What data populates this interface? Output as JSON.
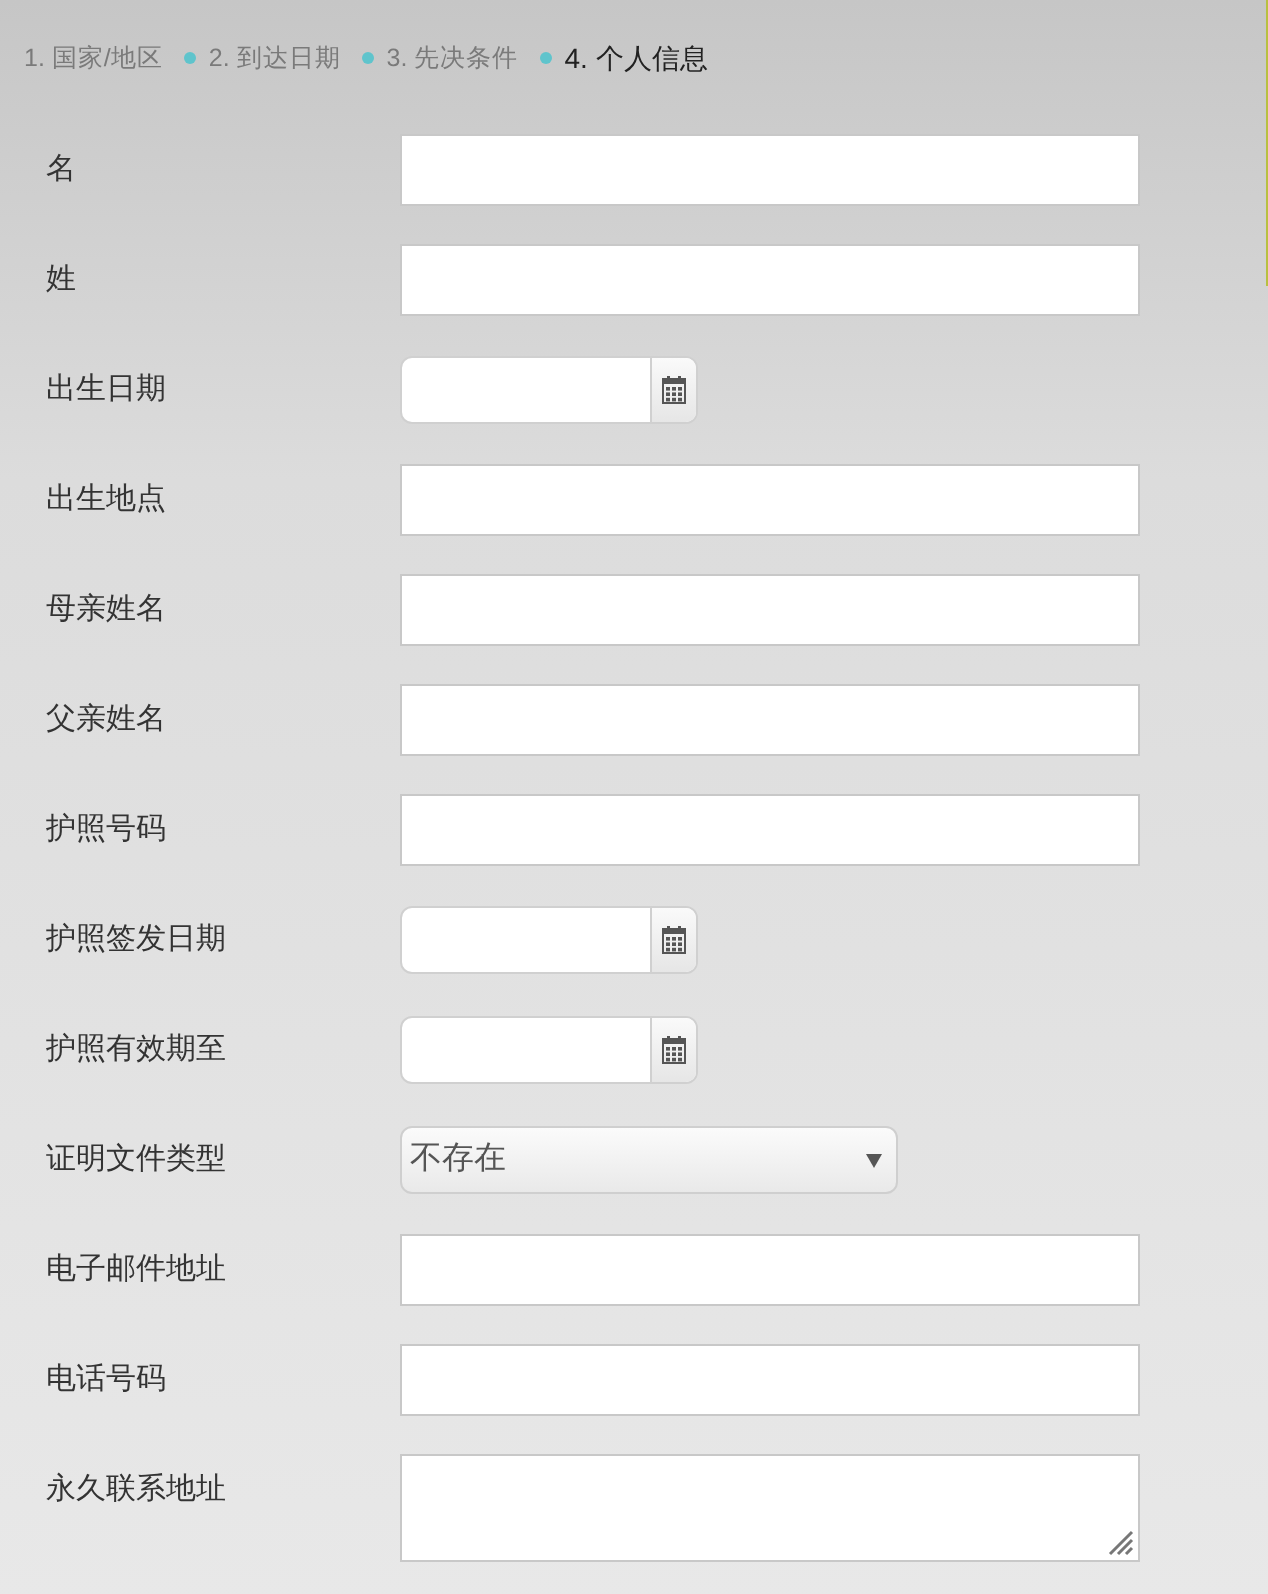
{
  "breadcrumb": [
    {
      "label": "1. 国家/地区",
      "selected": false
    },
    {
      "label": "2. 到达日期",
      "selected": false
    },
    {
      "label": "3. 先决条件",
      "selected": false
    },
    {
      "label": "4. 个人信息",
      "selected": true
    }
  ],
  "fields": [
    {
      "label": "名",
      "kind": "text"
    },
    {
      "label": "姓",
      "kind": "text"
    },
    {
      "label": "出生日期",
      "kind": "date"
    },
    {
      "label": "出生地点",
      "kind": "text"
    },
    {
      "label": "母亲姓名",
      "kind": "text"
    },
    {
      "label": "父亲姓名",
      "kind": "text"
    },
    {
      "label": "护照号码",
      "kind": "text"
    },
    {
      "label": "护照签发日期",
      "kind": "date"
    },
    {
      "label": "护照有效期至",
      "kind": "date"
    },
    {
      "label": "证明文件类型",
      "kind": "select",
      "value": "不存在"
    },
    {
      "label": "电子邮件地址",
      "kind": "text"
    },
    {
      "label": "电话号码",
      "kind": "text"
    },
    {
      "label": "永久联系地址",
      "kind": "textarea"
    }
  ]
}
